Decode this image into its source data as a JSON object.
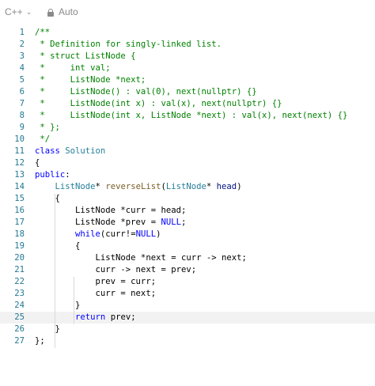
{
  "toolbar": {
    "language": "C++",
    "mode": "Auto"
  },
  "editor": {
    "active_line": 25,
    "lines": [
      {
        "num": "1",
        "tokens": [
          [
            "c",
            "/**"
          ]
        ]
      },
      {
        "num": "2",
        "tokens": [
          [
            "c",
            " * Definition for singly-linked list."
          ]
        ]
      },
      {
        "num": "3",
        "tokens": [
          [
            "c",
            " * struct ListNode {"
          ]
        ]
      },
      {
        "num": "4",
        "tokens": [
          [
            "c",
            " *     int val;"
          ]
        ]
      },
      {
        "num": "5",
        "tokens": [
          [
            "c",
            " *     ListNode *next;"
          ]
        ]
      },
      {
        "num": "6",
        "tokens": [
          [
            "c",
            " *     ListNode() : val(0), next(nullptr) {}"
          ]
        ]
      },
      {
        "num": "7",
        "tokens": [
          [
            "c",
            " *     ListNode(int x) : val(x), next(nullptr) {}"
          ]
        ]
      },
      {
        "num": "8",
        "tokens": [
          [
            "c",
            " *     ListNode(int x, ListNode *next) : val(x), next(next) {}"
          ]
        ]
      },
      {
        "num": "9",
        "tokens": [
          [
            "c",
            " * };"
          ]
        ]
      },
      {
        "num": "10",
        "tokens": [
          [
            "c",
            " */"
          ]
        ]
      },
      {
        "num": "11",
        "tokens": [
          [
            "k",
            "class"
          ],
          [
            "p",
            " "
          ],
          [
            "t",
            "Solution"
          ]
        ]
      },
      {
        "num": "12",
        "tokens": [
          [
            "p",
            "{"
          ]
        ]
      },
      {
        "num": "13",
        "tokens": [
          [
            "k",
            "public"
          ],
          [
            "p",
            ":"
          ]
        ]
      },
      {
        "num": "14",
        "tokens": [
          [
            "p",
            "    "
          ],
          [
            "t",
            "ListNode"
          ],
          [
            "p",
            "* "
          ],
          [
            "f",
            "reverseList"
          ],
          [
            "p",
            "("
          ],
          [
            "t",
            "ListNode"
          ],
          [
            "p",
            "* "
          ],
          [
            "n",
            "head"
          ],
          [
            "p",
            ")"
          ]
        ]
      },
      {
        "num": "15",
        "tokens": [
          [
            "p",
            "    {"
          ]
        ]
      },
      {
        "num": "16",
        "tokens": [
          [
            "p",
            "        ListNode *curr = head;"
          ]
        ]
      },
      {
        "num": "17",
        "tokens": [
          [
            "p",
            "        ListNode *prev = "
          ],
          [
            "k",
            "NULL"
          ],
          [
            "p",
            ";"
          ]
        ]
      },
      {
        "num": "18",
        "tokens": [
          [
            "p",
            "        "
          ],
          [
            "k",
            "while"
          ],
          [
            "p",
            "(curr!="
          ],
          [
            "k",
            "NULL"
          ],
          [
            "p",
            ")"
          ]
        ]
      },
      {
        "num": "19",
        "tokens": [
          [
            "p",
            "        {"
          ]
        ]
      },
      {
        "num": "20",
        "tokens": [
          [
            "p",
            "            ListNode *next = curr -> next;"
          ]
        ]
      },
      {
        "num": "21",
        "tokens": [
          [
            "p",
            "            curr -> next = prev;"
          ]
        ]
      },
      {
        "num": "22",
        "tokens": [
          [
            "p",
            "            prev = curr;"
          ]
        ]
      },
      {
        "num": "23",
        "tokens": [
          [
            "p",
            "            curr = next;"
          ]
        ]
      },
      {
        "num": "24",
        "tokens": [
          [
            "p",
            "        }"
          ]
        ]
      },
      {
        "num": "25",
        "tokens": [
          [
            "p",
            "        "
          ],
          [
            "k",
            "return"
          ],
          [
            "p",
            " prev;"
          ]
        ]
      },
      {
        "num": "26",
        "tokens": [
          [
            "p",
            "    }"
          ]
        ]
      },
      {
        "num": "27",
        "tokens": [
          [
            "p",
            "};"
          ]
        ]
      }
    ]
  }
}
